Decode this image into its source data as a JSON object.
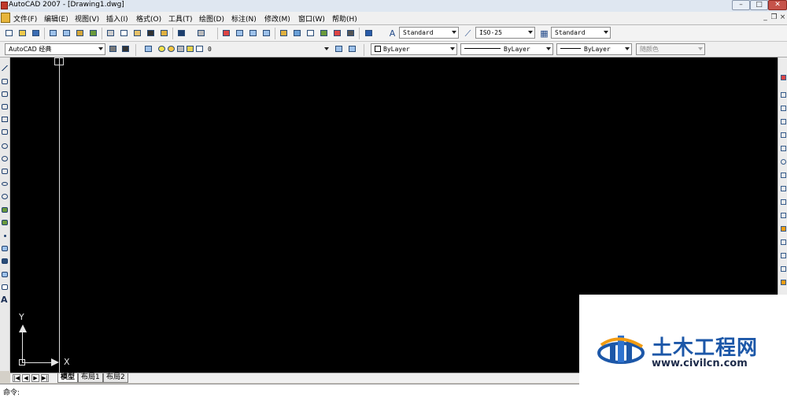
{
  "window": {
    "title": "AutoCAD 2007 - [Drawing1.dwg]",
    "controls": {
      "minimize": "–",
      "maximize": "□",
      "close": "✕"
    },
    "mdi_controls": {
      "minimize": "_",
      "restore": "❐",
      "close": "×"
    }
  },
  "menu": [
    "文件(F)",
    "编辑(E)",
    "视图(V)",
    "插入(I)",
    "格式(O)",
    "工具(T)",
    "绘图(D)",
    "标注(N)",
    "修改(M)",
    "窗口(W)",
    "帮助(H)"
  ],
  "styles_toolbar": {
    "text_style": "Standard",
    "dim_style": "ISO-25",
    "table_style": "Standard"
  },
  "workspace": {
    "value": "AutoCAD 经典"
  },
  "layer": {
    "value": "0"
  },
  "properties": {
    "color": "ByLayer",
    "linetype": "ByLayer",
    "lineweight": "ByLayer",
    "plotstyle": "随颜色"
  },
  "ucs": {
    "y_label": "Y",
    "x_label": "X"
  },
  "layout_tabs": {
    "nav": [
      "|◀",
      "◀",
      "▶",
      "▶|"
    ],
    "tabs": [
      "模型",
      "布局1",
      "布局2"
    ],
    "active": "模型"
  },
  "command": {
    "prompt": "命令:"
  },
  "watermark": {
    "brand_text": "土木工程网",
    "url": "www.civilcn.com",
    "colors": {
      "brand": "#1c57a8",
      "accent": "#f39c12"
    }
  },
  "colors": {
    "canvas": "#000000",
    "crosshair": "#d9d9d9",
    "toolbar_bg": "#f0f0f0"
  }
}
